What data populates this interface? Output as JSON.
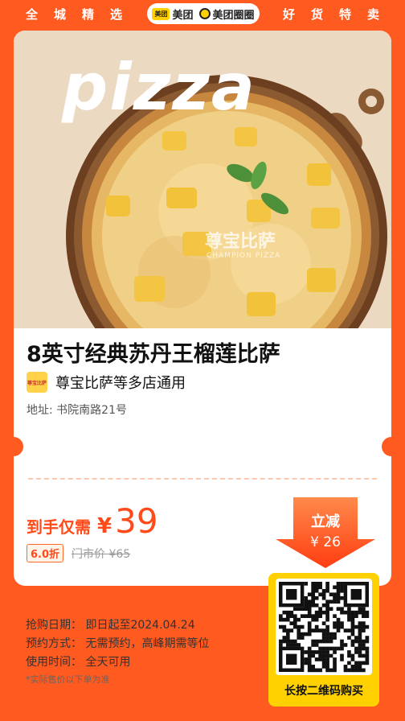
{
  "header": {
    "left_text": "全城精选",
    "right_text": "好货特卖",
    "brand_logo_text": "美团",
    "brand_name_1": "美团",
    "brand_name_2": "美团圈圈"
  },
  "hero": {
    "word": "pizza",
    "watermark": "尊宝比萨",
    "watermark_sub": "CHAMPION PIZZA"
  },
  "product": {
    "title": "8英寸经典苏丹王榴莲比萨",
    "store_logo_text": "尊宝比萨",
    "store_name": "尊宝比萨等多店通用",
    "address": "地址: 书院南路21号"
  },
  "price": {
    "label": "到手仅需",
    "currency": "¥",
    "value": "39",
    "discount": "6.0折",
    "original": "门市价 ¥65"
  },
  "savings": {
    "label": "立减",
    "amount": "¥ 26"
  },
  "info": {
    "purchase_date": "抢购日期：  即日起至2024.04.24",
    "reservation": "预约方式：  无需预约，高峰期需等位",
    "usage_time": "使用时间：  全天可用",
    "note": "*实际售价以下单为准"
  },
  "qr": {
    "label": "长按二维码购买"
  },
  "colors": {
    "background": "#ff5a1f",
    "accent": "#ff4a1a",
    "brand_yellow": "#ffd100"
  }
}
